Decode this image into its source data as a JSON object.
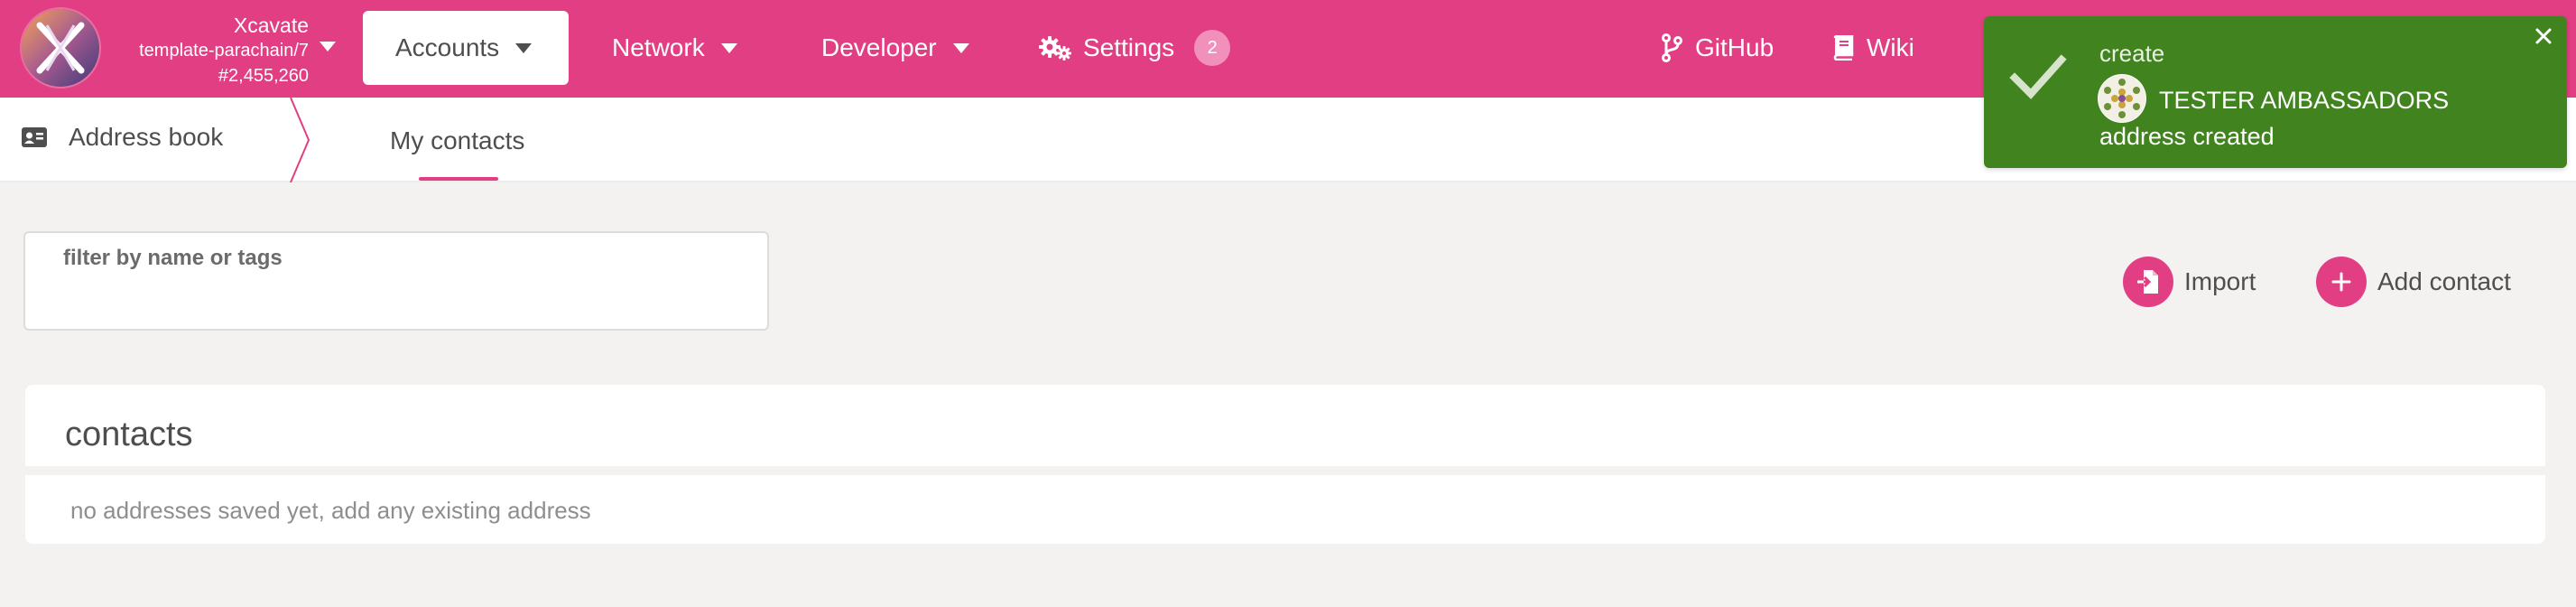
{
  "chain": {
    "name": "Xcavate",
    "runtime": "template-parachain/7",
    "block": "#2,455,260",
    "logo_icon": "xcavate-logo-icon"
  },
  "menu": {
    "accounts": "Accounts",
    "network": "Network",
    "developer": "Developer",
    "settings": "Settings",
    "settings_badge": "2",
    "github": "GitHub",
    "wiki": "Wiki"
  },
  "subnav": {
    "section": "Address book",
    "tab_active": "My contacts"
  },
  "filter": {
    "label": "filter by name or tags",
    "value": ""
  },
  "actions": {
    "import": "Import",
    "add_contact": "Add contact"
  },
  "contacts": {
    "title": "contacts",
    "empty_message": "no addresses saved yet, add any existing address"
  },
  "toast": {
    "action": "create",
    "account": "TESTER AMBASSADORS",
    "status": "address created"
  },
  "colors": {
    "brand": "#e23e83",
    "toast_success": "#41831e",
    "background": "#f3f2f1"
  }
}
